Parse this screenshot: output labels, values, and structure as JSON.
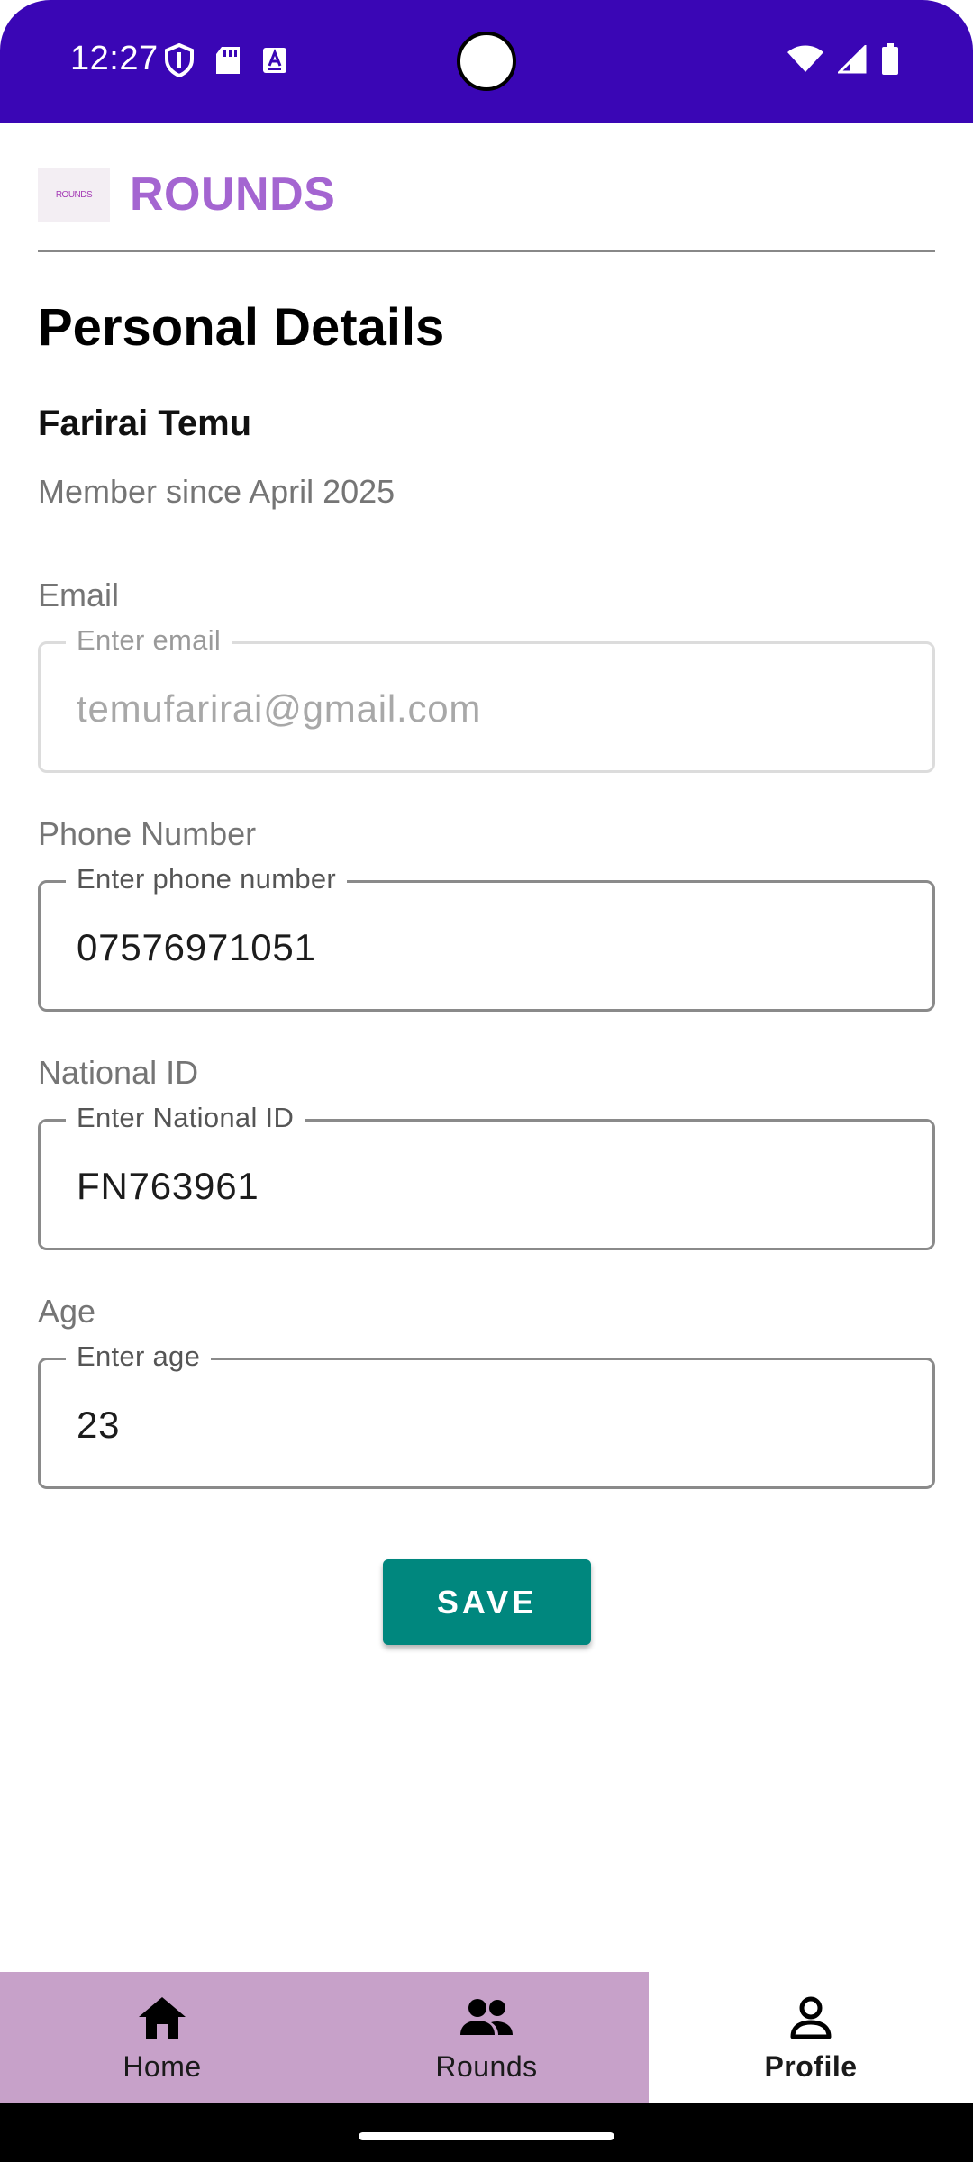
{
  "status_bar": {
    "time": "12:27",
    "left_icons": [
      "shield-icon",
      "sd-card-icon",
      "keyboard-a-icon"
    ],
    "right_icons": [
      "wifi-icon",
      "signal-icon",
      "battery-icon"
    ],
    "background": "#3a06b5"
  },
  "header": {
    "logo_text": "ROUNDS",
    "app_title": "ROUNDS",
    "title_color": "#a465d1"
  },
  "profile": {
    "page_title": "Personal Details",
    "name": "Farirai Temu",
    "member_since": "Member since April 2025"
  },
  "fields": {
    "email": {
      "label": "Email",
      "legend": "Enter email",
      "value": "temufarirai@gmail.com",
      "enabled": false
    },
    "phone": {
      "label": "Phone Number",
      "legend": "Enter phone number",
      "value": "07576971051",
      "enabled": true
    },
    "national_id": {
      "label": "National ID",
      "legend": "Enter National ID",
      "value": "FN763961",
      "enabled": true
    },
    "age": {
      "label": "Age",
      "legend": "Enter age",
      "value": "23",
      "enabled": true
    }
  },
  "save_button": {
    "label": "SAVE",
    "color": "#00877e"
  },
  "bottom_nav": {
    "items": [
      {
        "label": "Home",
        "icon": "home-icon",
        "active": false
      },
      {
        "label": "Rounds",
        "icon": "group-icon",
        "active": false
      },
      {
        "label": "Profile",
        "icon": "person-icon",
        "active": true
      }
    ],
    "inactive_color": "#c7a1c9"
  }
}
